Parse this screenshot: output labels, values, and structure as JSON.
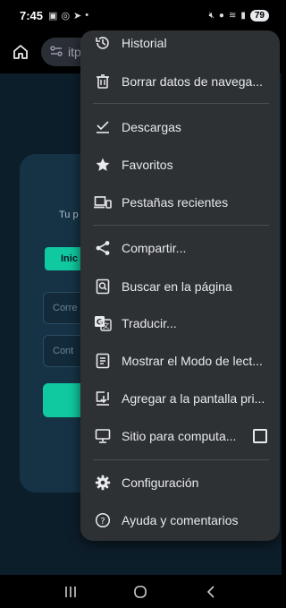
{
  "status_bar": {
    "time": "7:45",
    "battery": "79"
  },
  "menu": {
    "items": [
      {
        "label": "Historial",
        "icon": "history-icon"
      },
      {
        "label": "Borrar datos de navega...",
        "icon": "trash-icon"
      },
      {
        "label": "Descargas",
        "icon": "download-check-icon"
      },
      {
        "label": "Favoritos",
        "icon": "star-icon"
      },
      {
        "label": "Pestañas recientes",
        "icon": "devices-icon"
      },
      {
        "label": "Compartir...",
        "icon": "share-icon"
      },
      {
        "label": "Buscar en la página",
        "icon": "find-in-page-icon"
      },
      {
        "label": "Traducir...",
        "icon": "translate-icon"
      },
      {
        "label": "Mostrar el Modo de lect...",
        "icon": "reader-mode-icon"
      },
      {
        "label": "Agregar a la pantalla pri...",
        "icon": "add-to-home-icon"
      },
      {
        "label": "Sitio para computa...",
        "icon": "desktop-icon",
        "checked": false
      },
      {
        "label": "Configuración",
        "icon": "gear-icon"
      },
      {
        "label": "Ayuda y comentarios",
        "icon": "help-icon"
      }
    ]
  },
  "background_page": {
    "url_fragment": "itp",
    "card_text": "Tu p",
    "tab_label": "Inic",
    "email_placeholder": "Corre",
    "password_placeholder": "Cont"
  }
}
